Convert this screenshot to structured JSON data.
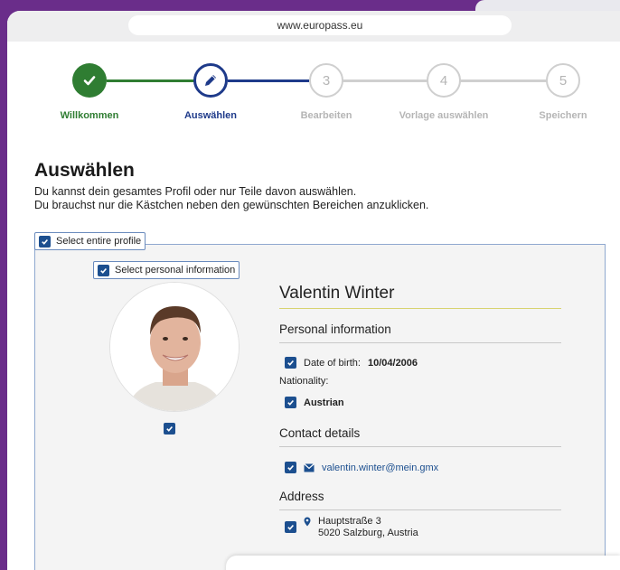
{
  "browser": {
    "url": "www.europass.eu"
  },
  "stepper": {
    "steps": [
      {
        "label": "Willkommen",
        "state": "done"
      },
      {
        "label": "Auswählen",
        "state": "active"
      },
      {
        "label": "Bearbeiten",
        "number": "3",
        "state": "todo"
      },
      {
        "label": "Vorlage auswählen",
        "number": "4",
        "state": "todo"
      },
      {
        "label": "Speichern",
        "number": "5",
        "state": "todo"
      }
    ]
  },
  "page": {
    "title": "Auswählen",
    "intro_line1": "Du kannst dein gesamtes Profil oder nur Teile davon auswählen.",
    "intro_line2": "Du brauchst nur die Kästchen neben den gewünschten Bereichen anzuklicken.",
    "select_entire_label": "Select entire profile"
  },
  "profile": {
    "select_personal_label": "Select personal information",
    "name": "Valentin Winter",
    "personal_info_title": "Personal information",
    "dob_label": "Date of birth:",
    "dob_value": "10/04/2006",
    "nationality_label": "Nationality:",
    "nationality_value": "Austrian",
    "contact_title": "Contact details",
    "email": "valentin.winter@mein.gmx",
    "address_title": "Address",
    "address_line1": "Hauptstraße 3",
    "address_line2": "5020 Salzburg, Austria"
  },
  "colors": {
    "accent": "#1c4f8f",
    "done": "#2f7d32",
    "brand_bg": "#6a2d8a"
  }
}
